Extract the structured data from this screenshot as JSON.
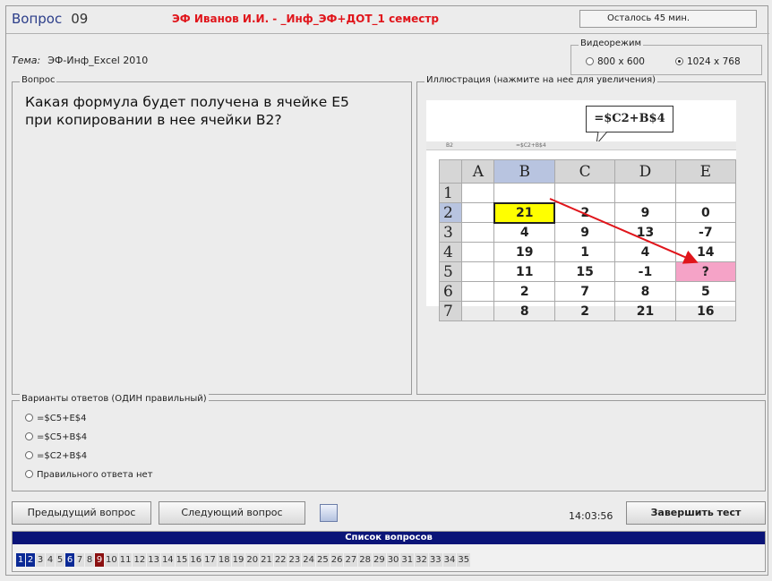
{
  "header": {
    "question_label": "Вопрос",
    "question_number": "09",
    "student": "ЭФ Иванов И.И. - _Инф_ЭФ+ДОТ_1 семестр",
    "remaining": "Осталось   45 мин."
  },
  "topic": {
    "label": "Тема:",
    "value": "ЭФ-Инф_Excel 2010"
  },
  "video_mode": {
    "legend": "Видеорежим",
    "options": [
      {
        "label": "800 x 600",
        "selected": false
      },
      {
        "label": "1024 x 768",
        "selected": true
      }
    ]
  },
  "question": {
    "legend": "Вопрос",
    "text": "Какая формула будет получена в ячейке Е5\nпри копировании в нее ячейки В2?"
  },
  "illustration": {
    "legend": "Иллюстрация (нажмите на нее для увеличения)",
    "callout": "=$C2+B$4",
    "formula_bar": {
      "name": "B2",
      "formula": "=$C2+B$4"
    },
    "columns": [
      "A",
      "B",
      "C",
      "D",
      "E"
    ],
    "rows": [
      {
        "num": "1",
        "cells": [
          "",
          "",
          "",
          "",
          ""
        ]
      },
      {
        "num": "2",
        "cells": [
          "",
          "21",
          "2",
          "9",
          "0"
        ]
      },
      {
        "num": "3",
        "cells": [
          "",
          "4",
          "9",
          "13",
          "-7"
        ]
      },
      {
        "num": "4",
        "cells": [
          "",
          "19",
          "1",
          "4",
          "14"
        ]
      },
      {
        "num": "5",
        "cells": [
          "",
          "11",
          "15",
          "-1",
          "?"
        ]
      },
      {
        "num": "6",
        "cells": [
          "",
          "2",
          "7",
          "8",
          "5"
        ]
      },
      {
        "num": "7",
        "cells": [
          "",
          "8",
          "2",
          "21",
          "16"
        ]
      }
    ],
    "highlight_color": "#ffff00",
    "target_color": "#f5a3c7",
    "arrow_color": "#e0151b"
  },
  "answers": {
    "legend": "Варианты ответов (ОДИН правильный)",
    "options": [
      "=$C5+E$4",
      "=$C5+B$4",
      "=$C2+B$4",
      "Правильного ответа нет"
    ]
  },
  "buttons": {
    "prev": "Предыдущий вопрос",
    "next": "Следующий вопрос",
    "finish": "Завершить тест"
  },
  "clock": "14:03:56",
  "question_list": {
    "title": "Список вопросов",
    "numbers": [
      "1",
      "2",
      "3",
      "4",
      "5",
      "6",
      "7",
      "8",
      "9",
      "10",
      "11",
      "12",
      "13",
      "14",
      "15",
      "16",
      "17",
      "18",
      "19",
      "20",
      "21",
      "22",
      "23",
      "24",
      "25",
      "26",
      "27",
      "28",
      "29",
      "30",
      "31",
      "32",
      "33",
      "34",
      "35"
    ],
    "answered": [
      "1",
      "2",
      "6"
    ],
    "current": "9"
  }
}
